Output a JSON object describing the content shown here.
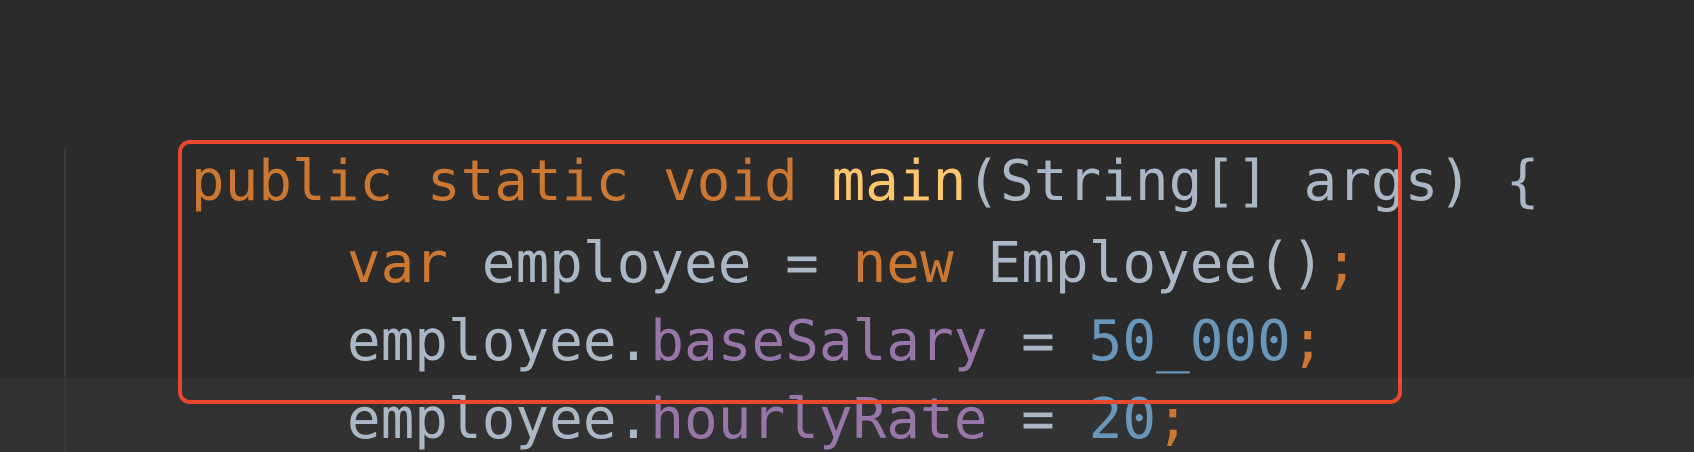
{
  "code": {
    "lines": [
      {
        "tokens": [
          {
            "text": "public",
            "kind": "keyword"
          },
          {
            "text": " ",
            "kind": "plain"
          },
          {
            "text": "static",
            "kind": "keyword"
          },
          {
            "text": " ",
            "kind": "plain"
          },
          {
            "text": "void",
            "kind": "keyword"
          },
          {
            "text": " ",
            "kind": "plain"
          },
          {
            "text": "main",
            "kind": "function"
          },
          {
            "text": "(String[] args) {",
            "kind": "plain"
          }
        ]
      },
      {
        "tokens": [
          {
            "text": "var",
            "kind": "keyword"
          },
          {
            "text": " employee = ",
            "kind": "plain"
          },
          {
            "text": "new",
            "kind": "keyword"
          },
          {
            "text": " Employee()",
            "kind": "plain"
          },
          {
            "text": ";",
            "kind": "semicolon"
          }
        ]
      },
      {
        "tokens": [
          {
            "text": "employee.",
            "kind": "plain"
          },
          {
            "text": "baseSalary",
            "kind": "field"
          },
          {
            "text": " = ",
            "kind": "plain"
          },
          {
            "text": "50_000",
            "kind": "number"
          },
          {
            "text": ";",
            "kind": "semicolon"
          }
        ]
      },
      {
        "tokens": [
          {
            "text": "employee.",
            "kind": "plain"
          },
          {
            "text": "hourlyRate",
            "kind": "field"
          },
          {
            "text": " = ",
            "kind": "plain"
          },
          {
            "text": "20",
            "kind": "number"
          },
          {
            "text": ";",
            "kind": "semicolon"
          }
        ]
      }
    ]
  },
  "colors": {
    "background": "#2b2b2b",
    "keyword": "#cc7832",
    "function": "#ffc66d",
    "plain": "#a9b7c6",
    "field": "#9876aa",
    "number": "#6897bb",
    "highlight_border": "#e8492e"
  }
}
